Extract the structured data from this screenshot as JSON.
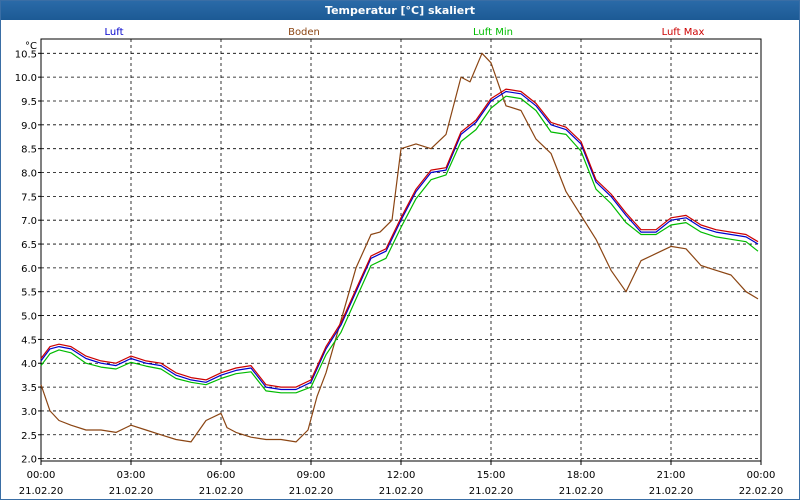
{
  "window": {
    "title": "Temperatur [°C] skaliert"
  },
  "chart_data": {
    "type": "line",
    "title": "Temperatur [°C] skaliert",
    "ylabel": "°C",
    "ylim": [
      1.95,
      10.8
    ],
    "yticks": [
      "2.0",
      "2.5",
      "3.0",
      "3.5",
      "4.0",
      "4.5",
      "5.0",
      "5.5",
      "6.0",
      "6.5",
      "7.0",
      "7.5",
      "8.0",
      "8.5",
      "9.0",
      "9.5",
      "10.0",
      "10.5"
    ],
    "xlim": [
      0,
      24
    ],
    "xticks": [
      {
        "time": "00:00",
        "date": "21.02.20"
      },
      {
        "time": "03:00",
        "date": "21.02.20"
      },
      {
        "time": "06:00",
        "date": "21.02.20"
      },
      {
        "time": "09:00",
        "date": "21.02.20"
      },
      {
        "time": "12:00",
        "date": "21.02.20"
      },
      {
        "time": "15:00",
        "date": "21.02.20"
      },
      {
        "time": "18:00",
        "date": "21.02.20"
      },
      {
        "time": "21:00",
        "date": "21.02.20"
      },
      {
        "time": "00:00",
        "date": "22.02.20"
      }
    ],
    "grid": true,
    "legend_position": "top",
    "series": [
      {
        "name": "Luft",
        "color": "#0000cc",
        "x": [
          0,
          0.3,
          0.6,
          1,
          1.5,
          2,
          2.5,
          3,
          3.5,
          4,
          4.5,
          5,
          5.5,
          6,
          6.5,
          7,
          7.5,
          8,
          8.5,
          9,
          9.5,
          10,
          10.5,
          11,
          11.5,
          12,
          12.5,
          13,
          13.5,
          14,
          14.5,
          15,
          15.5,
          16,
          16.5,
          17,
          17.5,
          18,
          18.5,
          19,
          19.5,
          20,
          20.5,
          21,
          21.5,
          22,
          22.5,
          23,
          23.5,
          23.9
        ],
        "values": [
          4.05,
          4.3,
          4.35,
          4.3,
          4.1,
          4.0,
          3.95,
          4.1,
          4.0,
          3.95,
          3.75,
          3.65,
          3.6,
          3.75,
          3.85,
          3.9,
          3.5,
          3.45,
          3.45,
          3.6,
          4.3,
          4.8,
          5.5,
          6.2,
          6.35,
          7.0,
          7.6,
          8.0,
          8.05,
          8.8,
          9.05,
          9.5,
          9.7,
          9.65,
          9.4,
          9.0,
          8.9,
          8.6,
          7.8,
          7.5,
          7.1,
          6.75,
          6.75,
          7.0,
          7.05,
          6.85,
          6.75,
          6.7,
          6.65,
          6.5
        ]
      },
      {
        "name": "Boden",
        "color": "#8b4513",
        "x": [
          0,
          0.3,
          0.6,
          1,
          1.5,
          2,
          2.5,
          3,
          3.5,
          4,
          4.5,
          5,
          5.5,
          6,
          6.2,
          6.5,
          7,
          7.5,
          8,
          8.5,
          8.9,
          9.2,
          9.5,
          10,
          10.5,
          11,
          11.3,
          11.7,
          12,
          12.5,
          13,
          13.5,
          14,
          14.3,
          14.7,
          15,
          15.5,
          16,
          16.5,
          17,
          17.5,
          18,
          18.5,
          19,
          19.5,
          20,
          20.5,
          21,
          21.5,
          22,
          22.5,
          23,
          23.5,
          23.9
        ],
        "values": [
          3.55,
          3.0,
          2.8,
          2.7,
          2.6,
          2.6,
          2.55,
          2.7,
          2.6,
          2.5,
          2.4,
          2.35,
          2.8,
          2.95,
          2.65,
          2.55,
          2.45,
          2.4,
          2.4,
          2.35,
          2.6,
          3.3,
          3.8,
          4.9,
          6.0,
          6.7,
          6.75,
          7.0,
          8.5,
          8.6,
          8.5,
          8.8,
          10.0,
          9.9,
          10.5,
          10.3,
          9.4,
          9.3,
          8.7,
          8.4,
          7.6,
          7.1,
          6.6,
          5.95,
          5.5,
          6.15,
          6.3,
          6.45,
          6.4,
          6.05,
          5.95,
          5.85,
          5.5,
          5.35
        ]
      },
      {
        "name": "Luft Min",
        "color": "#00bb00",
        "x": [
          0,
          0.3,
          0.6,
          1,
          1.5,
          2,
          2.5,
          3,
          3.5,
          4,
          4.5,
          5,
          5.5,
          6,
          6.5,
          7,
          7.5,
          8,
          8.5,
          9,
          9.5,
          10,
          10.5,
          11,
          11.5,
          12,
          12.5,
          13,
          13.5,
          14,
          14.5,
          15,
          15.5,
          16,
          16.5,
          17,
          17.5,
          18,
          18.5,
          19,
          19.5,
          20,
          20.5,
          21,
          21.5,
          22,
          22.5,
          23,
          23.5,
          23.9
        ],
        "values": [
          3.95,
          4.2,
          4.28,
          4.22,
          4.0,
          3.92,
          3.88,
          4.02,
          3.94,
          3.88,
          3.68,
          3.6,
          3.55,
          3.68,
          3.78,
          3.82,
          3.42,
          3.38,
          3.38,
          3.5,
          4.18,
          4.65,
          5.35,
          6.05,
          6.2,
          6.85,
          7.45,
          7.85,
          7.95,
          8.65,
          8.9,
          9.35,
          9.6,
          9.55,
          9.3,
          8.85,
          8.8,
          8.45,
          7.65,
          7.35,
          6.95,
          6.7,
          6.7,
          6.9,
          6.95,
          6.75,
          6.65,
          6.6,
          6.55,
          6.35
        ]
      },
      {
        "name": "Luft Max",
        "color": "#cc0000",
        "x": [
          0,
          0.3,
          0.6,
          1,
          1.5,
          2,
          2.5,
          3,
          3.5,
          4,
          4.5,
          5,
          5.5,
          6,
          6.5,
          7,
          7.5,
          8,
          8.5,
          9,
          9.5,
          10,
          10.5,
          11,
          11.5,
          12,
          12.5,
          13,
          13.5,
          14,
          14.5,
          15,
          15.5,
          16,
          16.5,
          17,
          17.5,
          18,
          18.5,
          19,
          19.5,
          20,
          20.5,
          21,
          21.5,
          22,
          22.5,
          23,
          23.5,
          23.9
        ],
        "values": [
          4.1,
          4.35,
          4.4,
          4.35,
          4.15,
          4.05,
          4.0,
          4.15,
          4.05,
          4.0,
          3.8,
          3.7,
          3.65,
          3.8,
          3.9,
          3.95,
          3.55,
          3.5,
          3.5,
          3.65,
          4.35,
          4.85,
          5.55,
          6.25,
          6.4,
          7.05,
          7.65,
          8.05,
          8.1,
          8.85,
          9.1,
          9.55,
          9.75,
          9.7,
          9.45,
          9.05,
          8.95,
          8.65,
          7.85,
          7.55,
          7.15,
          6.8,
          6.8,
          7.05,
          7.1,
          6.9,
          6.8,
          6.75,
          6.7,
          6.55
        ]
      }
    ]
  }
}
